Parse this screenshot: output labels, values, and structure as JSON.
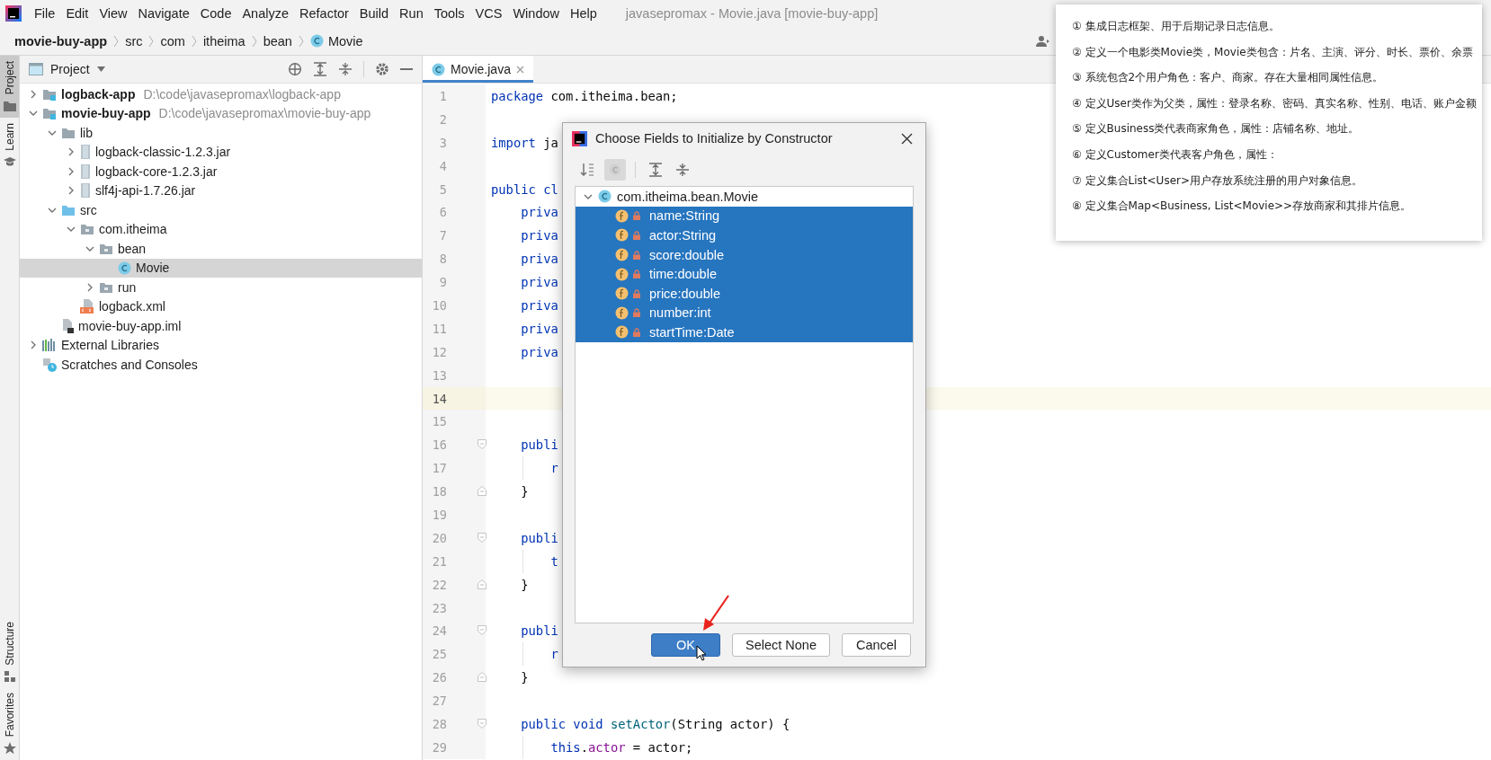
{
  "menu_bar": {
    "items": [
      "File",
      "Edit",
      "View",
      "Navigate",
      "Code",
      "Analyze",
      "Refactor",
      "Build",
      "Run",
      "Tools",
      "VCS",
      "Window",
      "Help"
    ],
    "title": "javasepromax - Movie.java [movie-buy-app]"
  },
  "breadcrumb": [
    {
      "label": "movie-buy-app",
      "kind": "module"
    },
    {
      "label": "src",
      "kind": "folder"
    },
    {
      "label": "com",
      "kind": "folder"
    },
    {
      "label": "itheima",
      "kind": "folder"
    },
    {
      "label": "bean",
      "kind": "folder"
    },
    {
      "label": "Movie",
      "kind": "class"
    }
  ],
  "tool_strip": {
    "top": [
      {
        "label": "Project",
        "kind": "folder",
        "selected": true
      },
      {
        "label": "Learn",
        "kind": "cap",
        "selected": false
      }
    ],
    "bottom": [
      {
        "label": "Structure",
        "kind": "structure",
        "selected": false
      },
      {
        "label": "Favorites",
        "kind": "star",
        "selected": false
      }
    ]
  },
  "project_panel": {
    "title": "Project",
    "tree": [
      {
        "label": "logback-app",
        "path": "D:\\code\\javasepromax\\logback-app",
        "kind": "module",
        "expanded": false,
        "selected": false
      },
      {
        "label": "movie-buy-app",
        "path": "D:\\code\\javasepromax\\movie-buy-app",
        "kind": "module",
        "expanded": true,
        "selected": false,
        "children": [
          {
            "label": "lib",
            "kind": "folder",
            "expanded": true,
            "selected": false,
            "children": [
              {
                "label": "logback-classic-1.2.3.jar",
                "kind": "jar",
                "expanded": false,
                "selected": false
              },
              {
                "label": "logback-core-1.2.3.jar",
                "kind": "jar",
                "expanded": false,
                "selected": false
              },
              {
                "label": "slf4j-api-1.7.26.jar",
                "kind": "jar",
                "expanded": false,
                "selected": false
              }
            ]
          },
          {
            "label": "src",
            "kind": "src",
            "expanded": true,
            "selected": false,
            "children": [
              {
                "label": "com.itheima",
                "kind": "package",
                "expanded": true,
                "selected": false,
                "children": [
                  {
                    "label": "bean",
                    "kind": "package",
                    "expanded": true,
                    "selected": false,
                    "children": [
                      {
                        "label": "Movie",
                        "kind": "class",
                        "selected": true
                      }
                    ]
                  },
                  {
                    "label": "run",
                    "kind": "package",
                    "expanded": false,
                    "selected": false
                  }
                ]
              },
              {
                "label": "logback.xml",
                "kind": "xml",
                "selected": false
              }
            ]
          },
          {
            "label": "movie-buy-app.iml",
            "kind": "iml",
            "selected": false
          }
        ]
      },
      {
        "label": "External Libraries",
        "kind": "libraries",
        "expanded": false,
        "selected": false
      },
      {
        "label": "Scratches and Consoles",
        "kind": "scratches",
        "selected": false
      }
    ]
  },
  "editor": {
    "tabs": [
      {
        "label": "Movie.java",
        "selected": true
      }
    ],
    "lines": [
      {
        "number": "1",
        "current": false,
        "tokens": [
          {
            "kind": "keyword",
            "text": "package "
          },
          {
            "kind": "plain",
            "text": "com.itheima.bean;"
          }
        ]
      },
      {
        "number": "2",
        "current": false
      },
      {
        "number": "3",
        "current": false,
        "tokens": [
          {
            "kind": "keyword",
            "text": "import "
          },
          {
            "kind": "plain",
            "text": "ja"
          }
        ]
      },
      {
        "number": "4",
        "current": false
      },
      {
        "number": "5",
        "current": false,
        "tokens": [
          {
            "kind": "keyword",
            "text": "public cl"
          }
        ]
      },
      {
        "number": "6",
        "current": false,
        "tokens": [
          {
            "kind": "keyword",
            "text": "    priva"
          }
        ]
      },
      {
        "number": "7",
        "current": false,
        "tokens": [
          {
            "kind": "keyword",
            "text": "    priva"
          }
        ]
      },
      {
        "number": "8",
        "current": false,
        "tokens": [
          {
            "kind": "keyword",
            "text": "    priva"
          }
        ]
      },
      {
        "number": "9",
        "current": false,
        "tokens": [
          {
            "kind": "keyword",
            "text": "    priva"
          }
        ]
      },
      {
        "number": "10",
        "current": false,
        "tokens": [
          {
            "kind": "keyword",
            "text": "    priva"
          }
        ]
      },
      {
        "number": "11",
        "current": false,
        "tokens": [
          {
            "kind": "keyword",
            "text": "    priva"
          }
        ]
      },
      {
        "number": "12",
        "current": false,
        "tokens": [
          {
            "kind": "keyword",
            "text": "    priva"
          }
        ]
      },
      {
        "number": "13",
        "current": false
      },
      {
        "number": "14",
        "current": true
      },
      {
        "number": "15",
        "current": false
      },
      {
        "number": "16",
        "current": false,
        "fold_open": true,
        "tokens": [
          {
            "kind": "keyword",
            "text": "    publi"
          }
        ]
      },
      {
        "number": "17",
        "current": false,
        "guide": true,
        "tokens": [
          {
            "kind": "keyword",
            "text": "        r"
          }
        ]
      },
      {
        "number": "18",
        "current": false,
        "fold_close": true,
        "tokens": [
          {
            "kind": "plain",
            "text": "    }"
          }
        ]
      },
      {
        "number": "19",
        "current": false
      },
      {
        "number": "20",
        "current": false,
        "fold_open": true,
        "tokens": [
          {
            "kind": "keyword",
            "text": "    publi"
          }
        ]
      },
      {
        "number": "21",
        "current": false,
        "guide": true,
        "tokens": [
          {
            "kind": "keyword",
            "text": "        t"
          }
        ]
      },
      {
        "number": "22",
        "current": false,
        "fold_close": true,
        "tokens": [
          {
            "kind": "plain",
            "text": "    }"
          }
        ]
      },
      {
        "number": "23",
        "current": false
      },
      {
        "number": "24",
        "current": false,
        "fold_open": true,
        "tokens": [
          {
            "kind": "keyword",
            "text": "    publi"
          }
        ]
      },
      {
        "number": "25",
        "current": false,
        "guide": true,
        "tokens": [
          {
            "kind": "keyword",
            "text": "        r"
          }
        ]
      },
      {
        "number": "26",
        "current": false,
        "fold_close": true,
        "tokens": [
          {
            "kind": "plain",
            "text": "    }"
          }
        ]
      },
      {
        "number": "27",
        "current": false
      },
      {
        "number": "28",
        "current": false,
        "fold_open": true,
        "tokens": [
          {
            "kind": "keyword",
            "text": "    public void "
          },
          {
            "kind": "method",
            "text": "setActor"
          },
          {
            "kind": "plain",
            "text": "(String actor) {"
          }
        ]
      },
      {
        "number": "29",
        "current": false,
        "guide": true,
        "tokens": [
          {
            "kind": "keyword",
            "text": "        this"
          },
          {
            "kind": "plain",
            "text": "."
          },
          {
            "kind": "field",
            "text": "actor"
          },
          {
            "kind": "plain",
            "text": " = actor;"
          }
        ]
      }
    ]
  },
  "dialog": {
    "title": "Choose Fields to Initialize by Constructor",
    "toolbar": [
      {
        "kind": "sort",
        "selected": false
      },
      {
        "kind": "classes",
        "selected": true
      },
      {
        "kind": "expand",
        "selected": false
      },
      {
        "kind": "collapse",
        "selected": false
      }
    ],
    "tree": {
      "label": "com.itheima.bean.Movie",
      "expanded": true,
      "selected": false,
      "children": [
        {
          "label": "name:String",
          "selected": true
        },
        {
          "label": "actor:String",
          "selected": true
        },
        {
          "label": "score:double",
          "selected": true
        },
        {
          "label": "time:double",
          "selected": true
        },
        {
          "label": "price:double",
          "selected": true
        },
        {
          "label": "number:int",
          "selected": true
        },
        {
          "label": "startTime:Date",
          "selected": true
        }
      ]
    },
    "buttons": [
      {
        "label": "OK",
        "kind": "primary"
      },
      {
        "label": "Select None",
        "kind": "normal"
      },
      {
        "label": "Cancel",
        "kind": "normal"
      }
    ]
  },
  "notes": [
    "① 集成日志框架、用于后期记录日志信息。",
    "② 定义一个电影类Movie类，Movie类包含：片名、主演、评分、时长、票价、余票",
    "③ 系统包含2个用户角色：客户、商家。存在大量相同属性信息。",
    "④ 定义User类作为父类，属性：登录名称、密码、真实名称、性别、电话、账户金额",
    "⑤ 定义Business类代表商家角色，属性：店铺名称、地址。",
    "⑥ 定义Customer类代表客户角色，属性：",
    "⑦ 定义集合List<User>用户存放系统注册的用户对象信息。",
    "⑧ 定义集合Map<Business, List<Movie>>存放商家和其排片信息。"
  ]
}
